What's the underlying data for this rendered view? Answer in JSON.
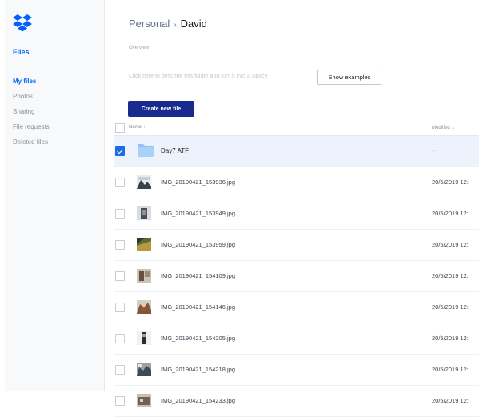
{
  "sidebar": {
    "logo": "dropbox-logo-icon",
    "heading": "Files",
    "items": [
      {
        "label": "My files",
        "active": true
      },
      {
        "label": "Photos",
        "active": false
      },
      {
        "label": "Sharing",
        "active": false
      },
      {
        "label": "File requests",
        "active": false
      },
      {
        "label": "Deleted files",
        "active": false
      }
    ]
  },
  "breadcrumb": {
    "parent": "Personal",
    "separator": "›",
    "current": "David"
  },
  "overview_label": "Overview",
  "description_placeholder": "Click here to describe this folder and turn it into a Space",
  "show_examples_label": "Show examples",
  "create_new_file_label": "Create new file",
  "list": {
    "name_header": "Name ↑",
    "modified_header": "Modified ⌄",
    "rows": [
      {
        "name": "Day7 ATF",
        "modified": "--",
        "type": "folder",
        "checked": true
      },
      {
        "name": "IMG_20190421_153936.jpg",
        "modified": "20/5/2019 12:",
        "type": "image",
        "checked": false
      },
      {
        "name": "IMG_20190421_153949.jpg",
        "modified": "20/5/2019 12:",
        "type": "image",
        "checked": false
      },
      {
        "name": "IMG_20190421_153959.jpg",
        "modified": "20/5/2019 12:",
        "type": "image",
        "checked": false
      },
      {
        "name": "IMG_20190421_154109.jpg",
        "modified": "20/5/2019 12:",
        "type": "image",
        "checked": false
      },
      {
        "name": "IMG_20190421_154146.jpg",
        "modified": "20/5/2019 12:",
        "type": "image",
        "checked": false
      },
      {
        "name": "IMG_20190421_154205.jpg",
        "modified": "20/5/2019 12:",
        "type": "image",
        "checked": false
      },
      {
        "name": "IMG_20190421_154218.jpg",
        "modified": "20/5/2019 12:",
        "type": "image",
        "checked": false
      },
      {
        "name": "IMG_20190421_154233.jpg",
        "modified": "20/5/2019 12:",
        "type": "image",
        "checked": false
      }
    ]
  },
  "colors": {
    "accent": "#0061fe",
    "create_button": "#1a2b8f",
    "selected_row": "#edf3fd",
    "folder": "#8fc3f5"
  }
}
